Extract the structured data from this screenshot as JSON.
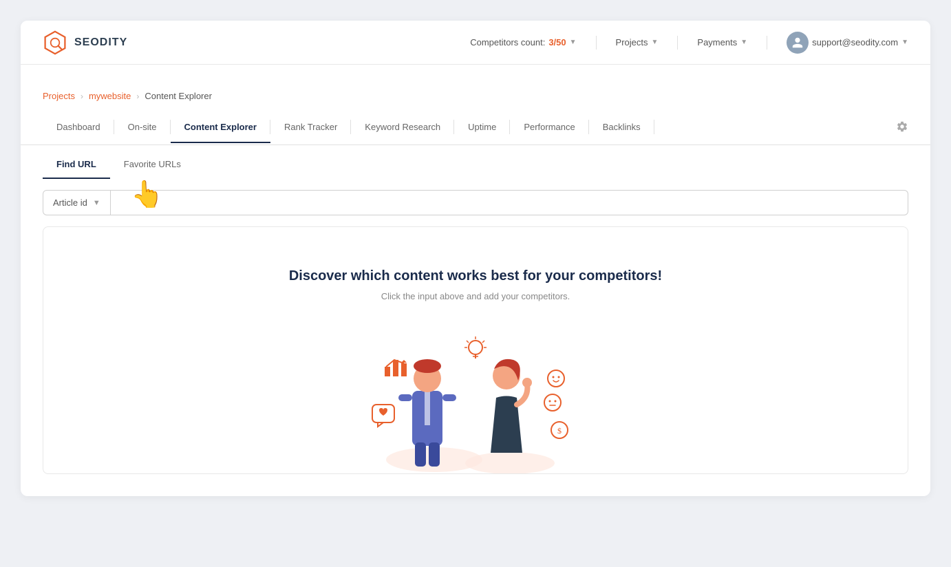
{
  "logo": {
    "text": "SEODITY"
  },
  "topbar": {
    "competitors_label": "Competitors count:",
    "competitors_value": "3/50",
    "projects_label": "Projects",
    "payments_label": "Payments",
    "user_email": "support@seodity.com"
  },
  "breadcrumb": {
    "projects": "Projects",
    "mywebsite": "mywebsite",
    "current": "Content Explorer"
  },
  "nav_tabs": [
    {
      "label": "Dashboard",
      "active": false
    },
    {
      "label": "On-site",
      "active": false
    },
    {
      "label": "Content Explorer",
      "active": true
    },
    {
      "label": "Rank Tracker",
      "active": false
    },
    {
      "label": "Keyword Research",
      "active": false
    },
    {
      "label": "Uptime",
      "active": false
    },
    {
      "label": "Performance",
      "active": false
    },
    {
      "label": "Backlinks",
      "active": false
    }
  ],
  "sub_tabs": [
    {
      "label": "Find URL",
      "active": true
    },
    {
      "label": "Favorite URLs",
      "active": false
    }
  ],
  "filter": {
    "dropdown_label": "Article id",
    "input_placeholder": ""
  },
  "empty_state": {
    "title": "Discover which content works best for your competitors!",
    "subtitle": "Click the input above and add your competitors."
  },
  "colors": {
    "accent": "#e8602c",
    "dark_navy": "#1a2b4b",
    "border": "#e0e0e0"
  }
}
